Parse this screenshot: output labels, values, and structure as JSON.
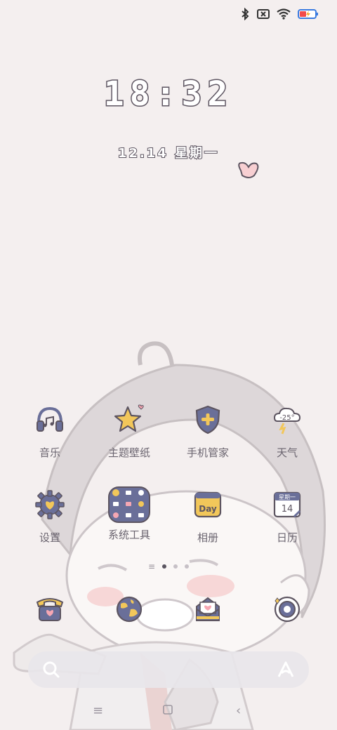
{
  "clock": {
    "time": "18:32"
  },
  "date": {
    "text": "12.14 星期一"
  },
  "apps_row1": [
    {
      "name": "音乐",
      "icon": "headphones-icon"
    },
    {
      "name": "主题壁纸",
      "icon": "star-icon"
    },
    {
      "name": "手机管家",
      "icon": "shield-icon"
    },
    {
      "name": "天气",
      "icon": "weather-cloud-icon",
      "temp": "-25°"
    }
  ],
  "apps_row2": [
    {
      "name": "设置",
      "icon": "gear-icon"
    },
    {
      "name": "系统工具",
      "icon": "folder-icon"
    },
    {
      "name": "相册",
      "icon": "day-calendar-icon",
      "badge": "Day"
    },
    {
      "name": "日历",
      "icon": "calendar-icon",
      "weekday": "星期一",
      "day": "14"
    }
  ],
  "dock": [
    {
      "icon": "phone-icon"
    },
    {
      "icon": "browser-globe-icon"
    },
    {
      "icon": "mail-icon"
    },
    {
      "icon": "camera-icon"
    }
  ],
  "colors": {
    "accent": "#6a6f99",
    "highlight": "#f2c75a",
    "heart": "#f6a7b3",
    "outline": "#5d5561"
  }
}
